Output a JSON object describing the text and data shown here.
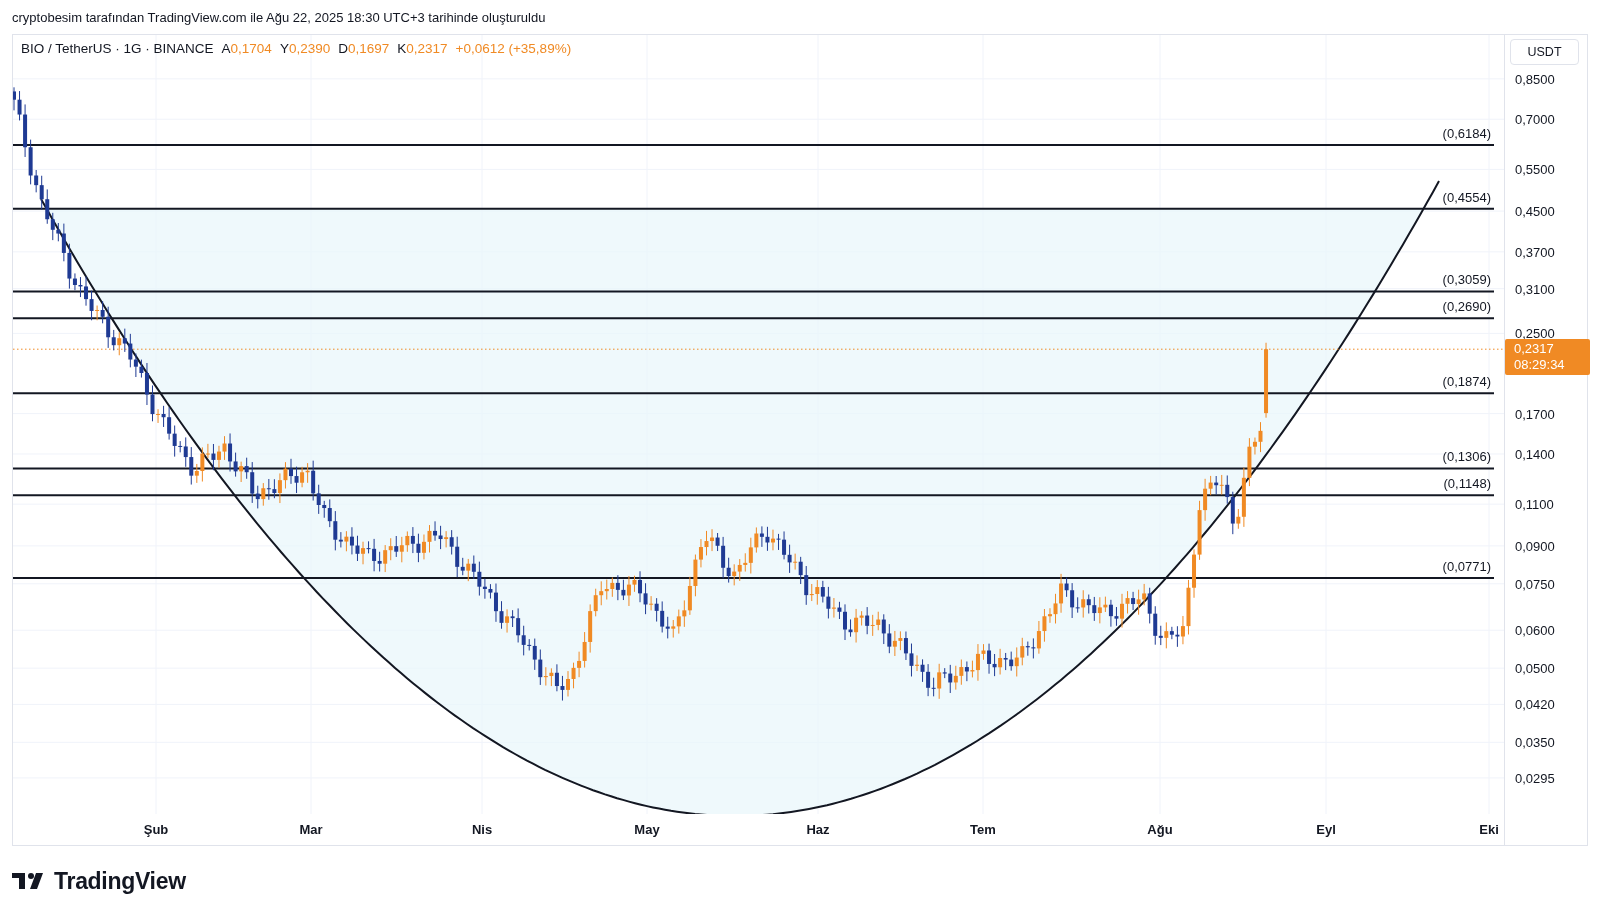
{
  "caption": "cryptobesim tarafından TradingView.com ile Ağu 22, 2025 18:30 UTC+3 tarihinde oluşturuldu",
  "legend": {
    "symbol": "BIO / TetherUS · 1G · BINANCE",
    "ohlc": [
      {
        "label": "A",
        "value": "0,1704"
      },
      {
        "label": "Y",
        "value": "0,2390"
      },
      {
        "label": "D",
        "value": "0,1697"
      },
      {
        "label": "K",
        "value": "0,2317"
      }
    ],
    "change": "+0,0612 (+35,89%)"
  },
  "levels": [
    "(0,6184)",
    "(0,4554)",
    "(0,3059)",
    "(0,2690)",
    "(0,1874)",
    "(0,1306)",
    "(0,1148)",
    "(0,0771)"
  ],
  "price_axis": {
    "currency": "USDT",
    "labels": [
      "0,8500",
      "0,7000",
      "0,5500",
      "0,4500",
      "0,3700",
      "0,3100",
      "0,2500",
      "0,1700",
      "0,1400",
      "0,1100",
      "0,0900",
      "0,0750",
      "0,0600",
      "0,0500",
      "0,0420",
      "0,0350",
      "0,0295"
    ]
  },
  "last_price": {
    "value": "0,2317",
    "countdown": "08:29:34"
  },
  "time_axis": [
    "Şub",
    "Mar",
    "Nis",
    "May",
    "Haz",
    "Tem",
    "Ağu",
    "Eyl",
    "Eki"
  ],
  "logo": "TradingView"
}
